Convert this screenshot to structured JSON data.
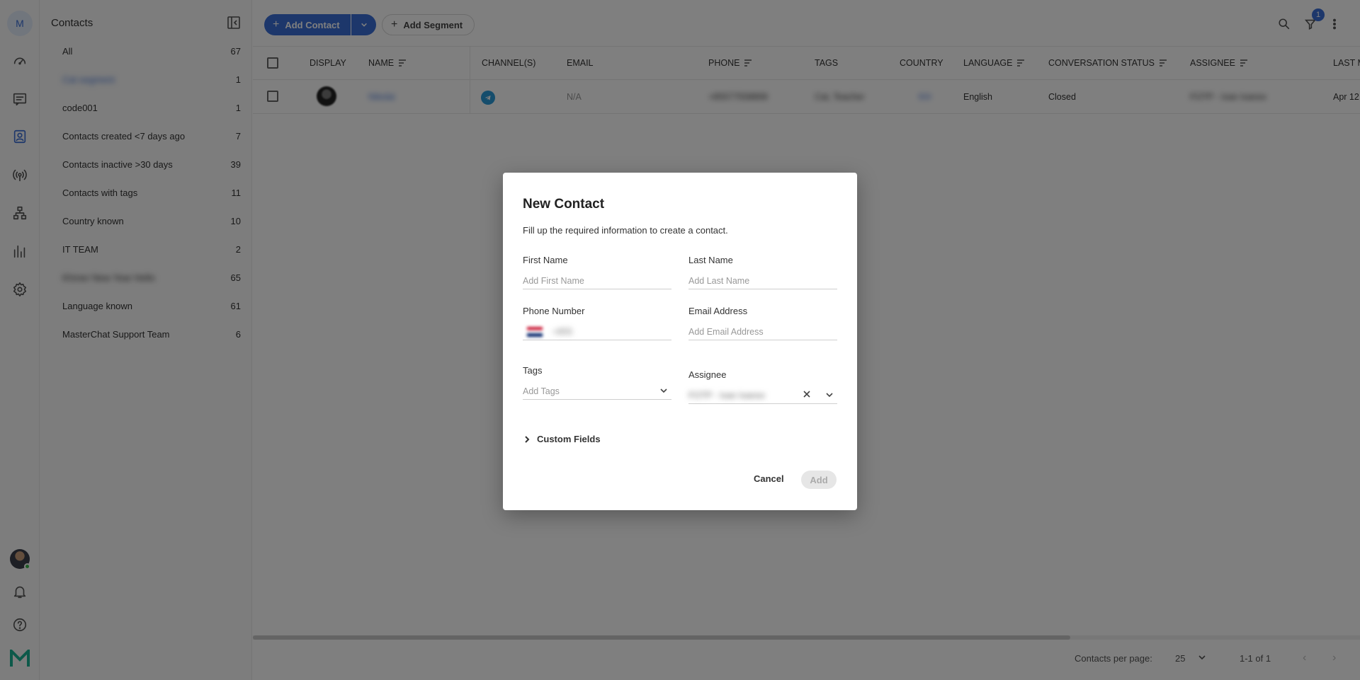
{
  "rail": {
    "avatar_letter": "M",
    "icons": [
      "dashboard-icon",
      "chat-icon",
      "contacts-icon",
      "broadcast-icon",
      "flow-icon",
      "reports-icon",
      "settings-icon",
      "bell-icon",
      "help-icon",
      "logo-icon"
    ]
  },
  "sidebar": {
    "title": "Contacts",
    "segments": [
      {
        "label": "All",
        "count": "67"
      },
      {
        "label": "Cat segment",
        "count": "1"
      },
      {
        "label": "code001",
        "count": "1"
      },
      {
        "label": "Contacts created <7 days ago",
        "count": "7"
      },
      {
        "label": "Contacts inactive >30 days",
        "count": "39"
      },
      {
        "label": "Contacts with tags",
        "count": "11"
      },
      {
        "label": "Country known",
        "count": "10"
      },
      {
        "label": "IT TEAM",
        "count": "2"
      },
      {
        "label": "Khmer New Year Hello",
        "count": "65"
      },
      {
        "label": "Language known",
        "count": "61"
      },
      {
        "label": "MasterChat Support Team",
        "count": "6"
      }
    ]
  },
  "toolbar": {
    "add_contact": "Add Contact",
    "add_segment": "Add Segment",
    "filter_badge": "1"
  },
  "table": {
    "headers": {
      "display": "DISPLAY",
      "name": "NAME",
      "channels": "CHANNEL(S)",
      "email": "EMAIL",
      "phone": "PHONE",
      "tags": "TAGS",
      "country": "COUNTRY",
      "language": "LANGUAGE",
      "conversation_status": "CONVERSATION STATUS",
      "assignee": "ASSIGNEE",
      "last": "LAST M"
    },
    "row": {
      "name": "Nikolai",
      "email": "N/A",
      "phone": "+85577558899",
      "tags": "Cat, Teacher",
      "country": "KH",
      "language": "English",
      "conversation_status": "Closed",
      "assignee": "FOTP - Ivan Ivanov",
      "last": "Apr 12"
    }
  },
  "footer": {
    "per_page_label": "Contacts per page:",
    "per_page_value": "25",
    "range": "1-1 of 1"
  },
  "modal": {
    "title": "New Contact",
    "subtitle": "Fill up the required information to create a contact.",
    "first_name": {
      "label": "First Name",
      "placeholder": "Add First Name"
    },
    "last_name": {
      "label": "Last Name",
      "placeholder": "Add Last Name"
    },
    "phone": {
      "label": "Phone Number",
      "prefix": "+855"
    },
    "email": {
      "label": "Email Address",
      "placeholder": "Add Email Address"
    },
    "tags": {
      "label": "Tags",
      "placeholder": "Add Tags"
    },
    "assignee": {
      "label": "Assignee",
      "value": "FOTP - Ivan Ivanov"
    },
    "custom_fields": "Custom Fields",
    "cancel": "Cancel",
    "add": "Add"
  },
  "colors": {
    "accent": "#3b6fd6",
    "telegram": "#2a9ad8",
    "overlay": "rgba(0,0,0,0.5)"
  }
}
